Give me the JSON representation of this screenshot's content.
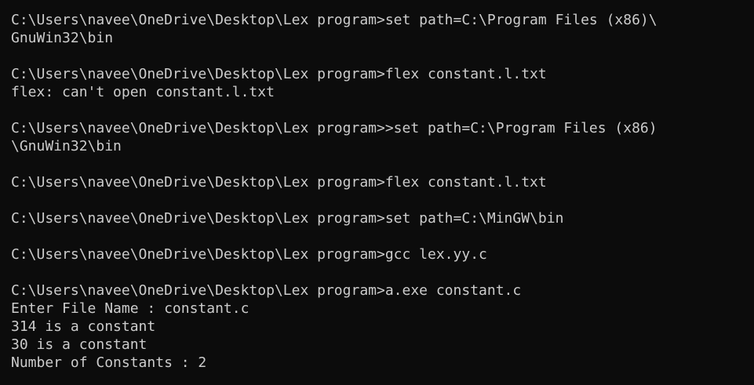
{
  "terminal": {
    "lines": [
      "C:\\Users\\navee\\OneDrive\\Desktop\\Lex program>set path=C:\\Program Files (x86)\\",
      "GnuWin32\\bin",
      "",
      "C:\\Users\\navee\\OneDrive\\Desktop\\Lex program>flex constant.l.txt",
      "flex: can't open constant.l.txt",
      "",
      "C:\\Users\\navee\\OneDrive\\Desktop\\Lex program>>set path=C:\\Program Files (x86)",
      "\\GnuWin32\\bin",
      "",
      "C:\\Users\\navee\\OneDrive\\Desktop\\Lex program>flex constant.l.txt",
      "",
      "C:\\Users\\navee\\OneDrive\\Desktop\\Lex program>set path=C:\\MinGW\\bin",
      "",
      "C:\\Users\\navee\\OneDrive\\Desktop\\Lex program>gcc lex.yy.c",
      "",
      "C:\\Users\\navee\\OneDrive\\Desktop\\Lex program>a.exe constant.c",
      "Enter File Name : constant.c",
      "314 is a constant",
      "30 is a constant",
      "Number of Constants : 2"
    ]
  },
  "colors": {
    "background": "#0c0c0c",
    "foreground": "#cccccc"
  }
}
